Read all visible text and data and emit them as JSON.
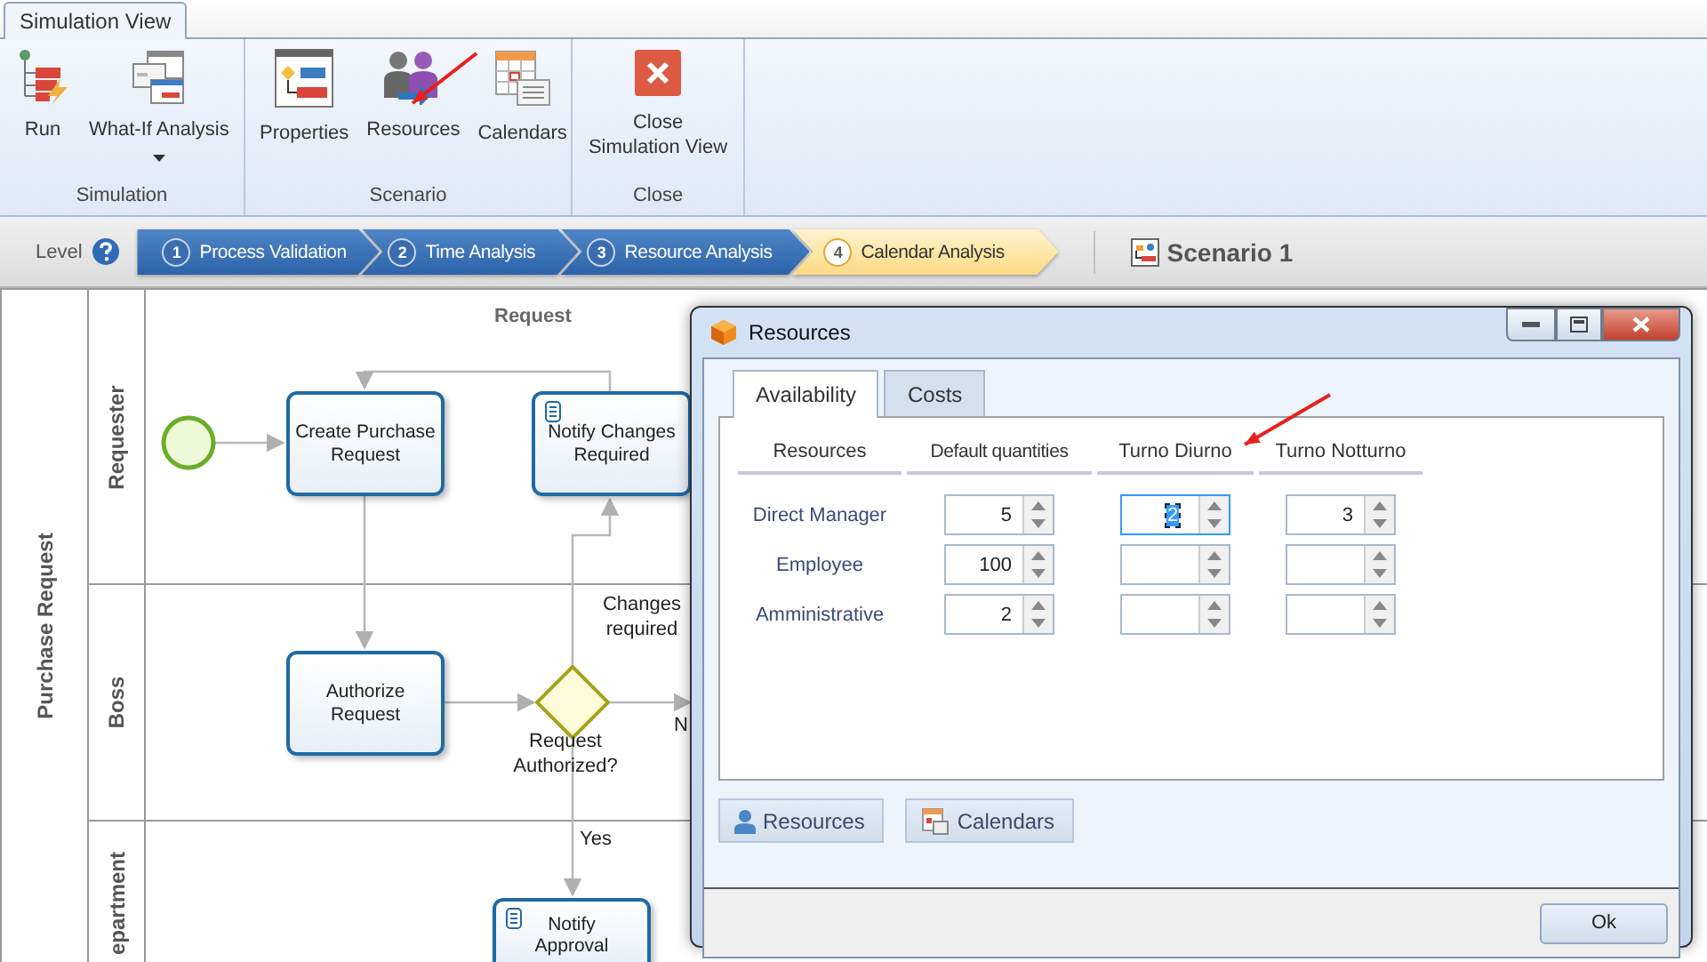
{
  "ribbon": {
    "tabs": [
      {
        "label": "Simulation View",
        "selected": true
      }
    ],
    "groups": [
      {
        "label": "Simulation",
        "buttons": [
          {
            "label": "Run",
            "dropdown": false
          },
          {
            "label": "What-If Analysis",
            "dropdown": true
          }
        ]
      },
      {
        "label": "Scenario",
        "buttons": [
          {
            "label": "Properties",
            "dropdown": false
          },
          {
            "label": "Resources",
            "dropdown": false
          },
          {
            "label": "Calendars",
            "dropdown": false
          }
        ]
      },
      {
        "label": "Close",
        "buttons": [
          {
            "label": "Close Simulation View",
            "dropdown": false
          }
        ]
      }
    ]
  },
  "level_bar": {
    "label": "Level",
    "steps": [
      {
        "number": "1",
        "label": "Process Validation",
        "selected": false
      },
      {
        "number": "2",
        "label": "Time Analysis",
        "selected": false
      },
      {
        "number": "3",
        "label": "Resource Analysis",
        "selected": false
      },
      {
        "number": "4",
        "label": "Calendar Analysis",
        "selected": true
      }
    ],
    "scenario": "Scenario 1"
  },
  "diagram": {
    "pool": "Purchase Request",
    "lanes": [
      {
        "label": "Requester"
      },
      {
        "label": "Boss"
      },
      {
        "label": "epartment"
      }
    ],
    "nodes": [
      {
        "kind": "start"
      },
      {
        "kind": "task",
        "label": "Create Purchase Request",
        "script": false
      },
      {
        "kind": "task",
        "label": "Notify Changes Required",
        "script": true
      },
      {
        "kind": "task",
        "label": "Authorize Request",
        "script": false
      },
      {
        "kind": "gateway"
      },
      {
        "kind": "task",
        "label": "Notify Approval",
        "script": true
      }
    ],
    "labels": [
      {
        "kind": "header",
        "text": "Request"
      },
      {
        "kind": "flow",
        "text": "Changes required"
      },
      {
        "kind": "gateway",
        "text": "Request Authorized?"
      },
      {
        "kind": "flow",
        "text": "N"
      },
      {
        "kind": "flow",
        "text": "Yes"
      }
    ]
  },
  "dialog": {
    "title": "Resources",
    "tabs": [
      {
        "label": "Availability",
        "selected": true
      },
      {
        "label": "Costs",
        "selected": false
      }
    ],
    "columns": [
      "Resources",
      "Default quantities",
      "Turno Diurno",
      "Turno Notturno"
    ],
    "rows": [
      {
        "cells": [
          {
            "kind": "label",
            "text": "Direct Manager"
          },
          {
            "kind": "spinner",
            "value": "5",
            "highlighted": false
          },
          {
            "kind": "spinner",
            "value": "2",
            "highlighted": true
          },
          {
            "kind": "spinner",
            "value": "3",
            "highlighted": false
          }
        ]
      },
      {
        "cells": [
          {
            "kind": "label",
            "text": "Employee"
          },
          {
            "kind": "spinner",
            "value": "100",
            "highlighted": false
          },
          {
            "kind": "spinner",
            "highlighted": false
          },
          {
            "kind": "spinner",
            "highlighted": false
          }
        ]
      },
      {
        "cells": [
          {
            "kind": "label",
            "text": "Amministrative"
          },
          {
            "kind": "spinner",
            "value": "2",
            "highlighted": false
          },
          {
            "kind": "spinner",
            "highlighted": false
          },
          {
            "kind": "spinner",
            "highlighted": false
          }
        ]
      }
    ],
    "buttons": [
      {
        "label": "Resources"
      },
      {
        "label": "Calendars"
      }
    ],
    "ok": "Ok"
  }
}
